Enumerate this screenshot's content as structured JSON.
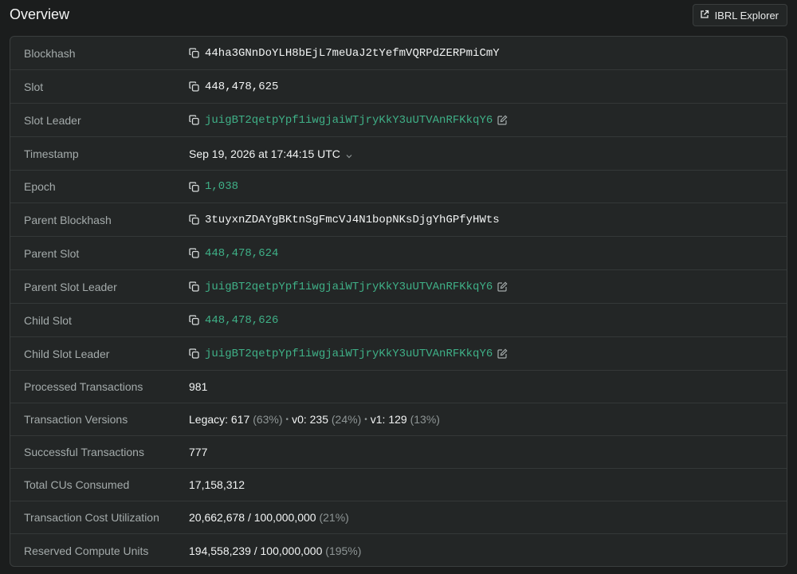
{
  "header": {
    "title": "Overview",
    "explorer_label": "IBRL Explorer"
  },
  "rows": {
    "blockhash": {
      "label": "Blockhash",
      "value": "44ha3GNnDoYLH8bEjL7meUaJ2tYefmVQRPdZERPmiCmY"
    },
    "slot": {
      "label": "Slot",
      "value": "448,478,625"
    },
    "slot_leader": {
      "label": "Slot Leader",
      "value": "juigBT2qetpYpf1iwgjaiWTjryKkY3uUTVAnRFKkqY6"
    },
    "timestamp": {
      "label": "Timestamp",
      "value": "Sep 19, 2026 at 17:44:15 UTC"
    },
    "epoch": {
      "label": "Epoch",
      "value": "1,038"
    },
    "parent_blockhash": {
      "label": "Parent Blockhash",
      "value": "3tuyxnZDAYgBKtnSgFmcVJ4N1bopNKsDjgYhGPfyHWts"
    },
    "parent_slot": {
      "label": "Parent Slot",
      "value": "448,478,624"
    },
    "parent_slot_leader": {
      "label": "Parent Slot Leader",
      "value": "juigBT2qetpYpf1iwgjaiWTjryKkY3uUTVAnRFKkqY6"
    },
    "child_slot": {
      "label": "Child Slot",
      "value": "448,478,626"
    },
    "child_slot_leader": {
      "label": "Child Slot Leader",
      "value": "juigBT2qetpYpf1iwgjaiWTjryKkY3uUTVAnRFKkqY6"
    },
    "processed_tx": {
      "label": "Processed Transactions",
      "value": "981"
    },
    "tx_versions": {
      "label": "Transaction Versions",
      "legacy": "Legacy: 617",
      "legacy_pct": "(63%)",
      "v0": "v0: 235",
      "v0_pct": "(24%)",
      "v1": "v1: 129",
      "v1_pct": "(13%)",
      "separator": "•"
    },
    "successful_tx": {
      "label": "Successful Transactions",
      "value": "777"
    },
    "total_cus": {
      "label": "Total CUs Consumed",
      "value": "17,158,312"
    },
    "tx_cost_util": {
      "label": "Transaction Cost Utilization",
      "value": "20,662,678 / 100,000,000",
      "pct": "(21%)"
    },
    "reserved_cu": {
      "label": "Reserved Compute Units",
      "value": "194,558,239 / 100,000,000",
      "pct": "(195%)"
    }
  },
  "colors": {
    "background": "#1b1d1d",
    "card": "#232626",
    "link": "#3fb087",
    "label": "#a4abab"
  }
}
